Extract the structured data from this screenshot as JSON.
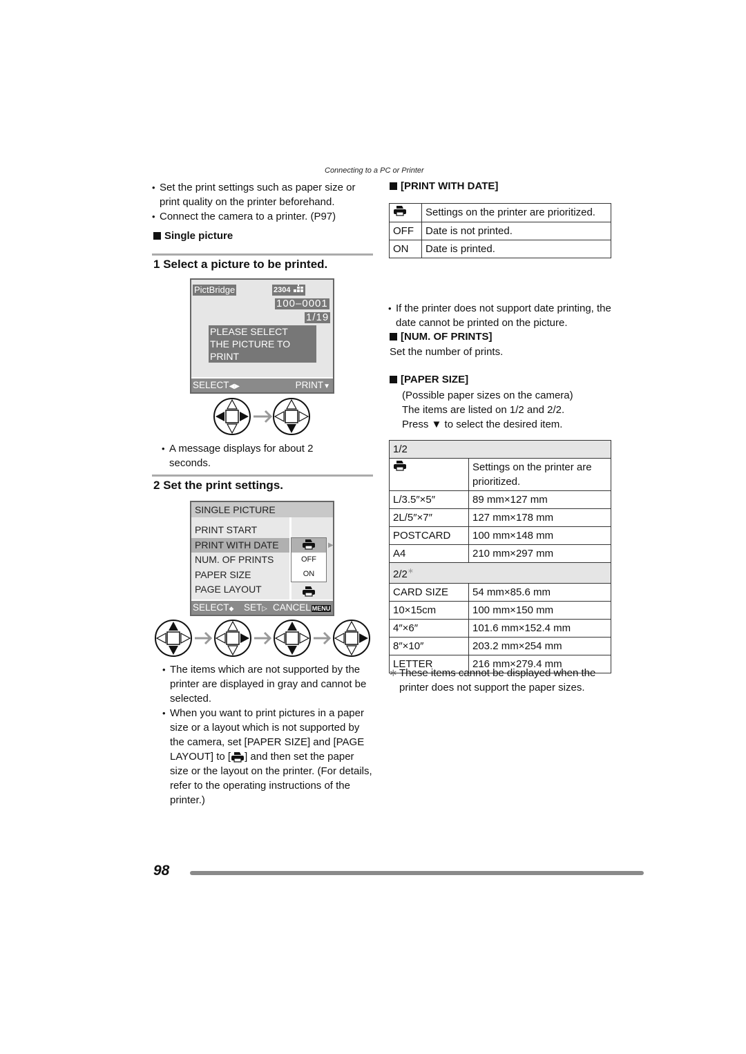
{
  "header": {
    "section": "Connecting to a PC or Printer"
  },
  "left": {
    "intro_bullets": [
      "Set the print settings such as paper size or print quality on the printer beforehand.",
      "Connect the camera to a printer. (P97)"
    ],
    "subhead": "Single picture",
    "step1": {
      "num": "1",
      "title": "Select a picture to be printed."
    },
    "lcd1": {
      "pictbridge": "PictBridge",
      "resolution": "2304",
      "file_no": "100–0001",
      "counter": "1/19",
      "message_line1": "PLEASE SELECT",
      "message_line2": "THE PICTURE TO PRINT",
      "select_label": "SELECT",
      "print_label": "PRINT"
    },
    "step1_note": "A message displays for about 2 seconds.",
    "step2": {
      "num": "2",
      "title": "Set the print settings."
    },
    "lcd2": {
      "title": "SINGLE PICTURE",
      "items": [
        "PRINT START",
        "PRINT WITH DATE",
        "NUM. OF PRINTS",
        "PAPER SIZE",
        "PAGE LAYOUT"
      ],
      "selected_index": 1,
      "dropdown_options": [
        "OFF",
        "ON"
      ],
      "select_label": "SELECT",
      "set_label": "SET",
      "cancel_label": "CANCEL",
      "menu_label": "MENU"
    },
    "step2_bullets": [
      "The items which are not supported by the printer are displayed in gray and cannot be selected.",
      "When you want to print pictures in a paper size or a layout which is not supported by the camera, set [PAPER SIZE] and [PAGE LAYOUT] to [",
      "] and then set the paper size or the layout on the printer. (For details, refer to the operating instructions of the printer.)"
    ]
  },
  "right": {
    "print_with_date": {
      "heading": "[PRINT WITH DATE]",
      "rows": [
        {
          "key_icon": "printer-icon",
          "key": "",
          "value": "Settings on the printer are prioritized."
        },
        {
          "key": "OFF",
          "value": "Date is not printed."
        },
        {
          "key": "ON",
          "value": "Date is printed."
        }
      ],
      "note": "If the printer does not support date printing, the date cannot be printed on the picture."
    },
    "num_of_prints": {
      "heading": "[NUM. OF PRINTS]",
      "text": "Set the number of prints."
    },
    "paper_size": {
      "heading": "[PAPER SIZE]",
      "desc_line1": "(Possible paper sizes on the camera)",
      "desc_line2": "The items are listed on 1/2 and 2/2.",
      "desc_line3_pre": "Press",
      "desc_line3_post": "to select the desired item.",
      "page1_label": "1/2",
      "page1_rows": [
        {
          "key": "",
          "key_icon": "printer-icon",
          "value": "Settings on the printer are prioritized."
        },
        {
          "key": "L/3.5″×5″",
          "value": "89 mm×127 mm"
        },
        {
          "key": "2L/5″×7″",
          "value": "127 mm×178 mm"
        },
        {
          "key": "POSTCARD",
          "value": "100 mm×148 mm"
        },
        {
          "key": "A4",
          "value": "210 mm×297 mm"
        }
      ],
      "page2_label": "2/2",
      "page2_mark": "∗",
      "page2_rows": [
        {
          "key": "CARD SIZE",
          "value": "54 mm×85.6 mm"
        },
        {
          "key": "10×15cm",
          "value": "100 mm×150 mm"
        },
        {
          "key": "4″×6″",
          "value": "101.6 mm×152.4 mm"
        },
        {
          "key": "8″×10″",
          "value": "203.2 mm×254 mm"
        },
        {
          "key": "LETTER",
          "value": "216 mm×279.4 mm"
        }
      ],
      "footnote_mark": "∗",
      "footnote": "These items cannot be displayed when the printer does not support the paper sizes."
    }
  },
  "footer": {
    "page_number": "98"
  }
}
